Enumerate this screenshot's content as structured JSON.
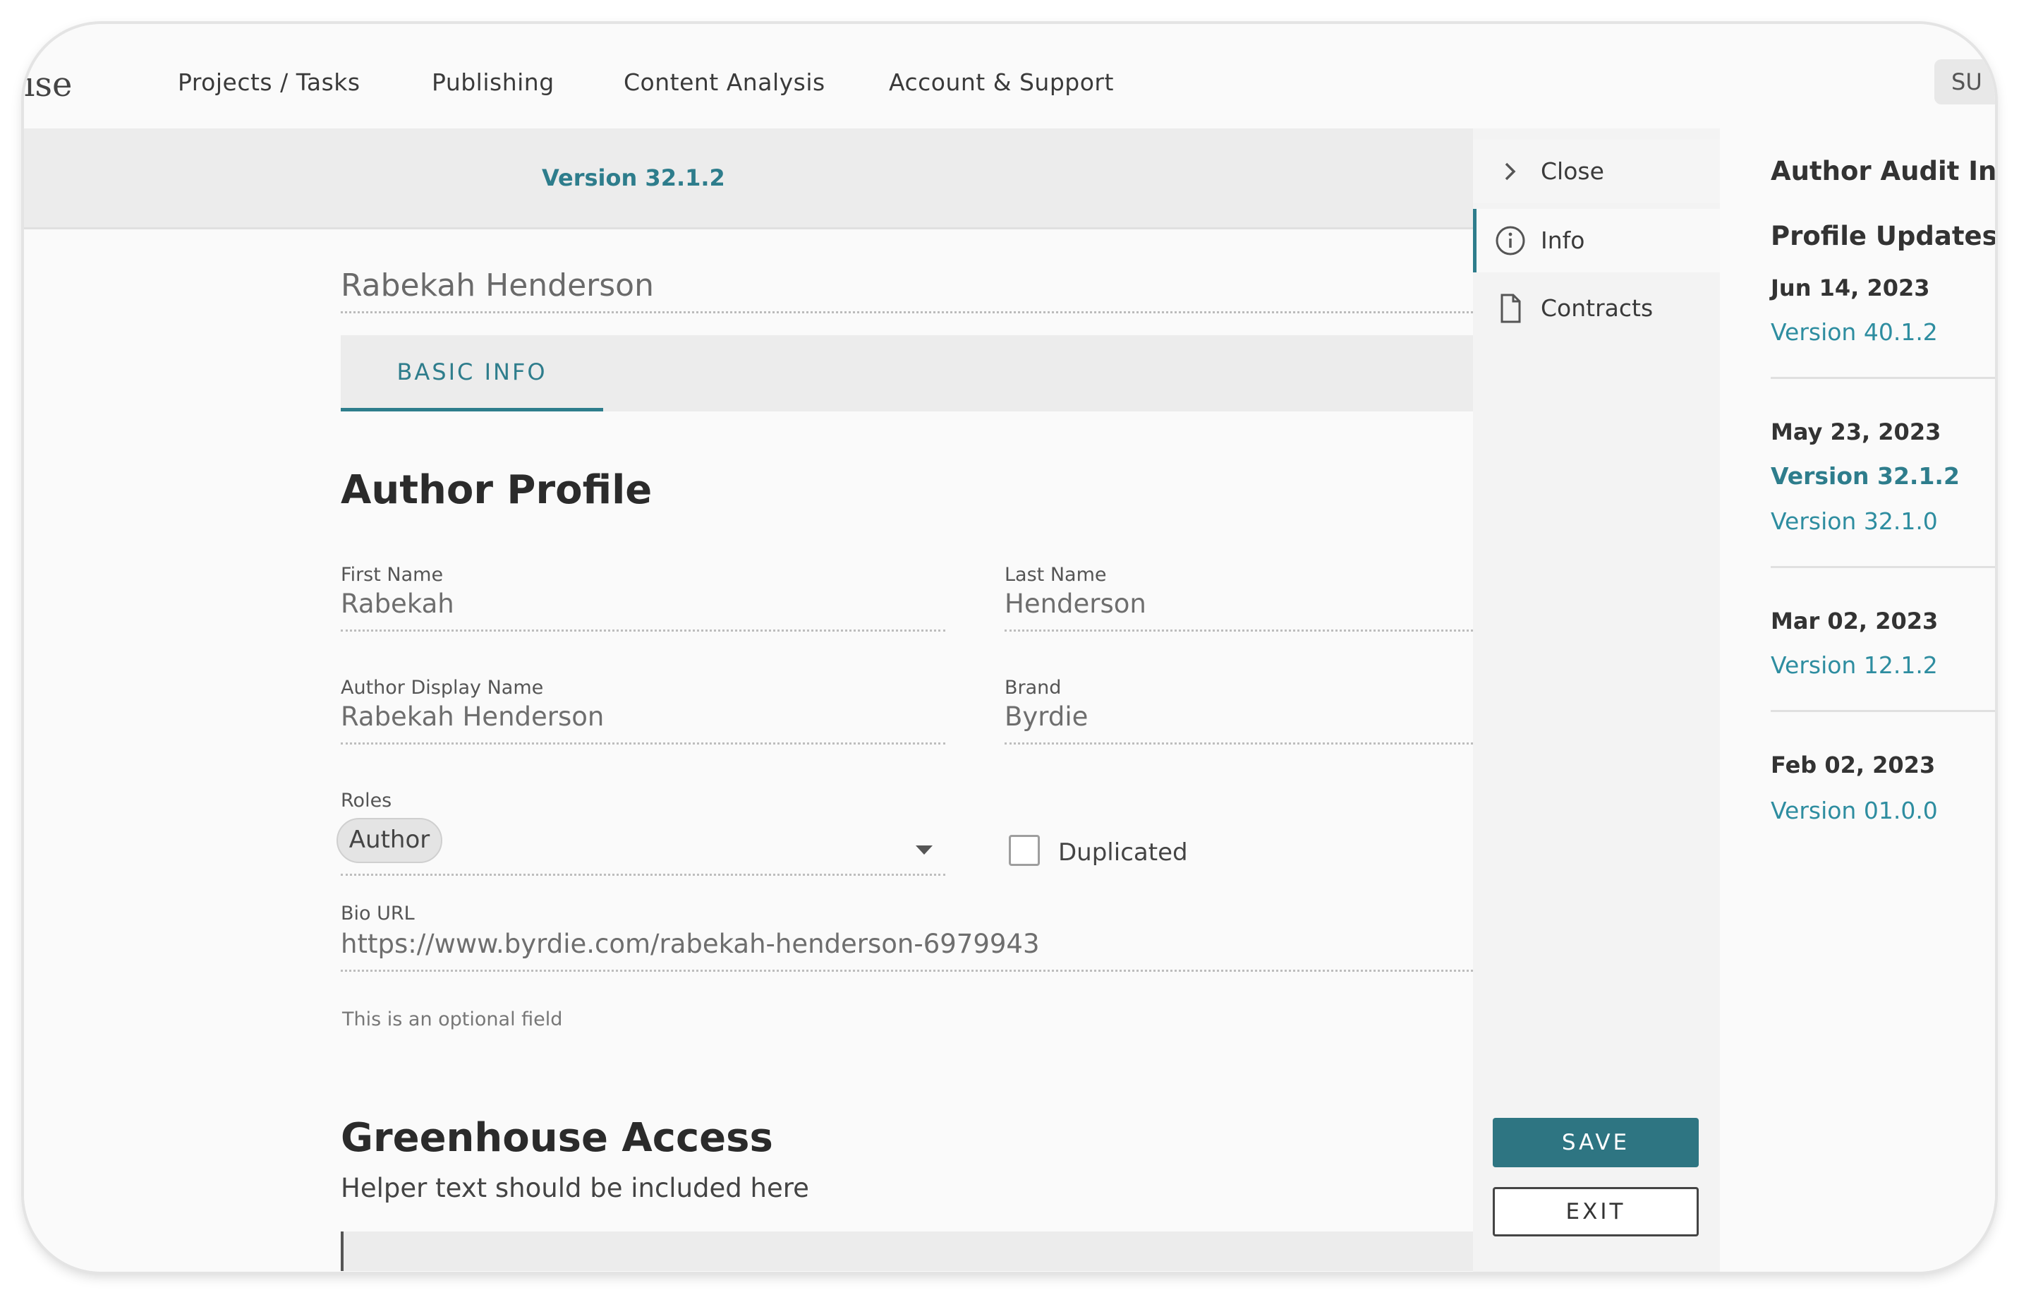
{
  "nav": {
    "brand_fragment": "ıse",
    "items": [
      {
        "label": "Projects / Tasks"
      },
      {
        "label": "Publishing"
      },
      {
        "label": "Content Analysis"
      },
      {
        "label": "Account & Support"
      }
    ],
    "right_button": "SU"
  },
  "version_bar": {
    "version": "Version 32.1.2"
  },
  "author": {
    "name": "Rabekah Henderson"
  },
  "tabs": [
    {
      "label": "BASIC INFO",
      "active": true
    }
  ],
  "profile": {
    "title": "Author Profile",
    "first_name": {
      "label": "First Name",
      "value": "Rabekah"
    },
    "last_name": {
      "label": "Last Name",
      "value": "Henderson"
    },
    "display_name": {
      "label": "Author Display Name",
      "value": "Rabekah Henderson"
    },
    "brand": {
      "label": "Brand",
      "value": "Byrdie"
    },
    "roles": {
      "label": "Roles",
      "chip": "Author"
    },
    "duplicated": {
      "label": "Duplicated",
      "checked": false
    },
    "bio_url": {
      "label": "Bio URL",
      "value": "https://www.byrdie.com/rabekah-henderson-6979943",
      "helper": "This is an optional field"
    }
  },
  "greenhouse": {
    "title": "Greenhouse Access",
    "helper": "Helper text should be included here"
  },
  "side_panel": {
    "close": "Close",
    "info": "Info",
    "contracts": "Contracts",
    "save": "SAVE",
    "exit": "EXIT"
  },
  "audit": {
    "title": "Author Audit Info",
    "subtitle": "Profile Updates",
    "groups": [
      {
        "date": "Jun 14, 2023",
        "versions": [
          "Version 40.1.2"
        ]
      },
      {
        "date": "May 23, 2023",
        "versions": [
          "Version 32.1.2",
          "Version 32.1.0"
        ]
      },
      {
        "date": "Mar 02, 2023",
        "versions": [
          "Version 12.1.2"
        ]
      },
      {
        "date": "Feb 02, 2023",
        "versions": [
          "Version 01.0.0"
        ]
      }
    ]
  },
  "colors": {
    "accent": "#2e7d8c",
    "save_button": "#2e7582"
  }
}
